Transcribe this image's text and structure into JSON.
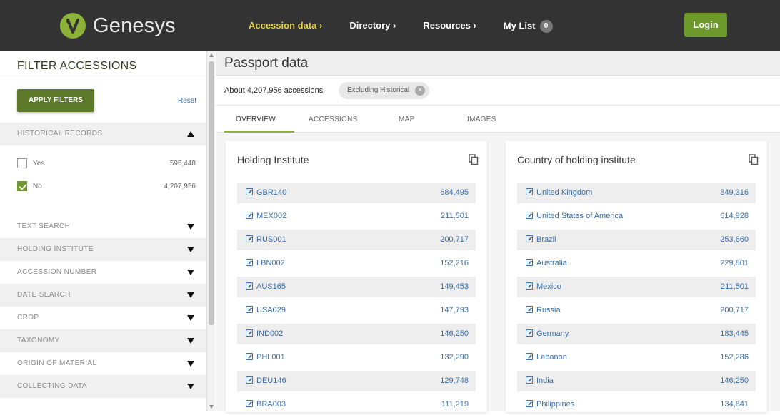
{
  "header": {
    "logo_text": "Genesys",
    "nav": [
      {
        "label": "Accession data ›",
        "active": true
      },
      {
        "label": "Directory ›",
        "active": false
      },
      {
        "label": "Resources ›",
        "active": false
      },
      {
        "label": "My List",
        "active": false,
        "badge": "0"
      }
    ],
    "login_label": "Login"
  },
  "sidebar": {
    "title": "FILTER ACCESSIONS",
    "apply_label": "APPLY FILTERS",
    "reset_label": "Reset",
    "historical": {
      "label": "HISTORICAL RECORDS",
      "options": [
        {
          "label": "Yes",
          "count": "595,448",
          "checked": false
        },
        {
          "label": "No",
          "count": "4,207,956",
          "checked": true
        }
      ]
    },
    "sections": [
      "TEXT SEARCH",
      "HOLDING INSTITUTE",
      "ACCESSION NUMBER",
      "DATE SEARCH",
      "CROP",
      "TAXONOMY",
      "ORIGIN OF MATERIAL",
      "COLLECTING DATA"
    ]
  },
  "main": {
    "title": "Passport data",
    "summary": "About 4,207,956 accessions",
    "chip_label": "Excluding Historical",
    "tabs": [
      {
        "label": "OVERVIEW",
        "active": true
      },
      {
        "label": "ACCESSIONS",
        "active": false
      },
      {
        "label": "MAP",
        "active": false
      },
      {
        "label": "IMAGES",
        "active": false
      }
    ],
    "cards": [
      {
        "title": "Holding Institute",
        "rows": [
          {
            "label": "GBR140",
            "value": "684,495"
          },
          {
            "label": "MEX002",
            "value": "211,501"
          },
          {
            "label": "RUS001",
            "value": "200,717"
          },
          {
            "label": "LBN002",
            "value": "152,216"
          },
          {
            "label": "AUS165",
            "value": "149,453"
          },
          {
            "label": "USA029",
            "value": "147,793"
          },
          {
            "label": "IND002",
            "value": "146,250"
          },
          {
            "label": "PHL001",
            "value": "132,290"
          },
          {
            "label": "DEU146",
            "value": "129,748"
          },
          {
            "label": "BRA003",
            "value": "111,219"
          }
        ]
      },
      {
        "title": "Country of holding institute",
        "rows": [
          {
            "label": "United Kingdom",
            "value": "849,316"
          },
          {
            "label": "United States of America",
            "value": "614,928"
          },
          {
            "label": "Brazil",
            "value": "253,660"
          },
          {
            "label": "Australia",
            "value": "229,801"
          },
          {
            "label": "Mexico",
            "value": "211,501"
          },
          {
            "label": "Russia",
            "value": "200,717"
          },
          {
            "label": "Germany",
            "value": "183,445"
          },
          {
            "label": "Lebanon",
            "value": "152,286"
          },
          {
            "label": "India",
            "value": "146,250"
          },
          {
            "label": "Philippines",
            "value": "134,841"
          }
        ]
      }
    ]
  },
  "colors": {
    "brand_green": "#6e9a2c",
    "nav_active": "#e4d042",
    "link_blue": "#3a6ea5",
    "topbar": "#333333"
  }
}
